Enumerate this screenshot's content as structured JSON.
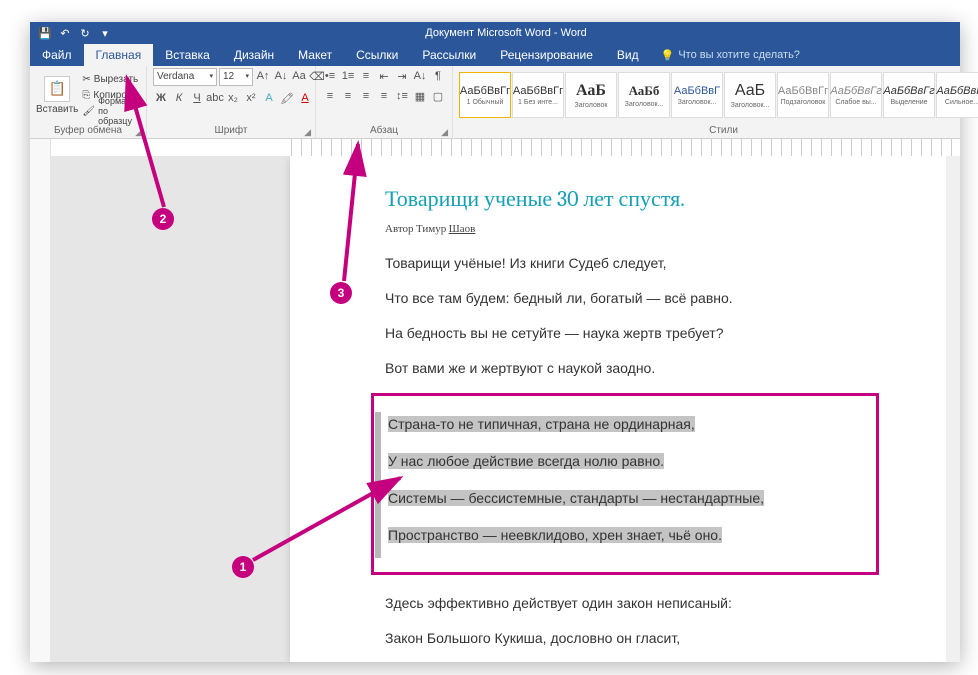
{
  "titlebar": {
    "title": "Документ Microsoft Word - Word"
  },
  "tabs": {
    "file": "Файл",
    "home": "Главная",
    "insert": "Вставка",
    "design": "Дизайн",
    "layout": "Макет",
    "references": "Ссылки",
    "mailings": "Рассылки",
    "review": "Рецензирование",
    "view": "Вид",
    "tellme": "Что вы хотите сделать?"
  },
  "ribbon": {
    "clipboard": {
      "paste": "Вставить",
      "cut": "Вырезать",
      "copy": "Копировать",
      "format_painter": "Формат по образцу",
      "label": "Буфер обмена"
    },
    "font": {
      "name": "Verdana",
      "size": "12",
      "label": "Шрифт"
    },
    "paragraph": {
      "label": "Абзац"
    },
    "styles": {
      "label": "Стили",
      "items": [
        {
          "preview": "АаБбВвГг",
          "name": "1 Обычный"
        },
        {
          "preview": "АаБбВвГг",
          "name": "1 Без инте..."
        },
        {
          "preview": "АаБ",
          "name": "Заголовок"
        },
        {
          "preview": "АаБб",
          "name": "Заголовок..."
        },
        {
          "preview": "АаБбВвГ",
          "name": "Заголовок..."
        },
        {
          "preview": "АаБ",
          "name": "Заголовок..."
        },
        {
          "preview": "АаБбВвГг",
          "name": "Подзаголовок"
        },
        {
          "preview": "АаБбВвГг",
          "name": "Слабое вы..."
        },
        {
          "preview": "АаБбВвГг",
          "name": "Выделение"
        },
        {
          "preview": "АаБбВвГг",
          "name": "Сильное..."
        }
      ]
    }
  },
  "document": {
    "title": "Товарищи ученые 30 лет спустя.",
    "author_prefix": "Автор Тимур ",
    "author_link": "Шаов",
    "lines1": [
      "Товарищи учёные! Из книги Судеб следует,",
      "Что все там будем: бедный ли, богатый — всё равно.",
      "На бедность вы не сетуйте — наука жертв требует?",
      "Вот вами же и жертвуют с наукой заодно."
    ],
    "lines_selected": [
      "Страна-то не типичная, страна не ординарная,",
      "У нас любое действие всегда нолю равно.",
      "Системы — бессистемные, стандарты — нестандартные,",
      "Пространство — неевклидово, хрен знает, чьё оно."
    ],
    "lines2": [
      "Здесь эффективно действует один закон неписаный:",
      "Закон Большого Кукиша, дословно он гласит,"
    ]
  },
  "annotations": {
    "n1": "1",
    "n2": "2",
    "n3": "3"
  }
}
